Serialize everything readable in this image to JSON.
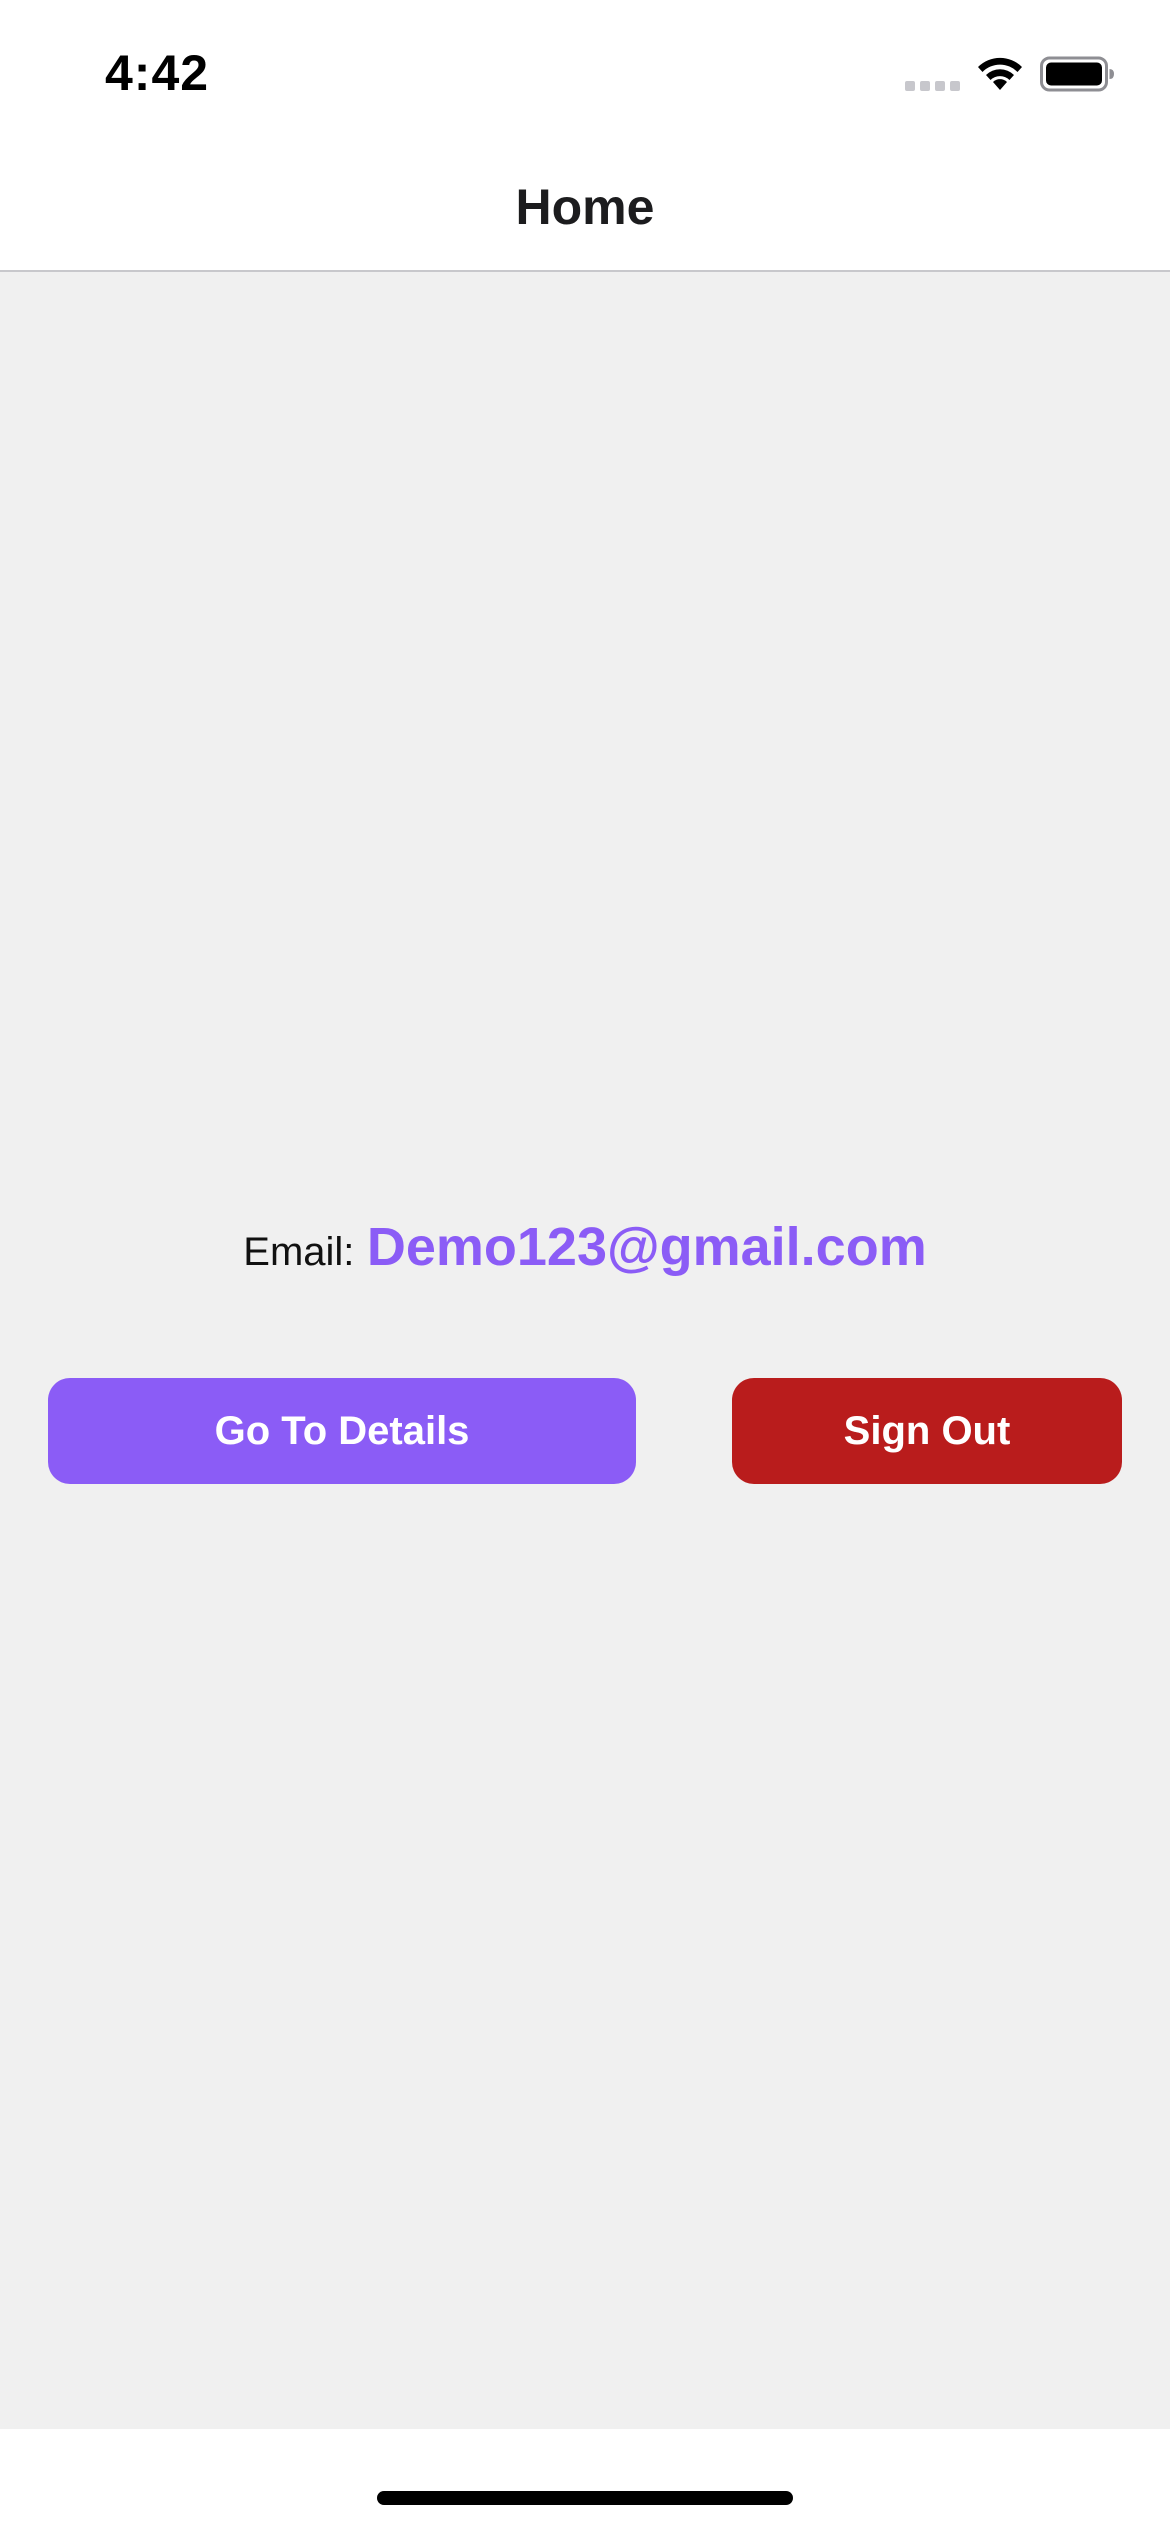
{
  "status_bar": {
    "time": "4:42",
    "icons": [
      "signal-icon",
      "wifi-icon",
      "battery-icon"
    ]
  },
  "header": {
    "title": "Home"
  },
  "main": {
    "email_label": "Email:",
    "email_value": "Demo123@gmail.com",
    "details_button_label": "Go To Details",
    "signout_button_label": "Sign Out"
  },
  "colors": {
    "accent_purple": "#8b5cf6",
    "danger_red": "#b91c1c",
    "background": "#f0f0f0"
  }
}
